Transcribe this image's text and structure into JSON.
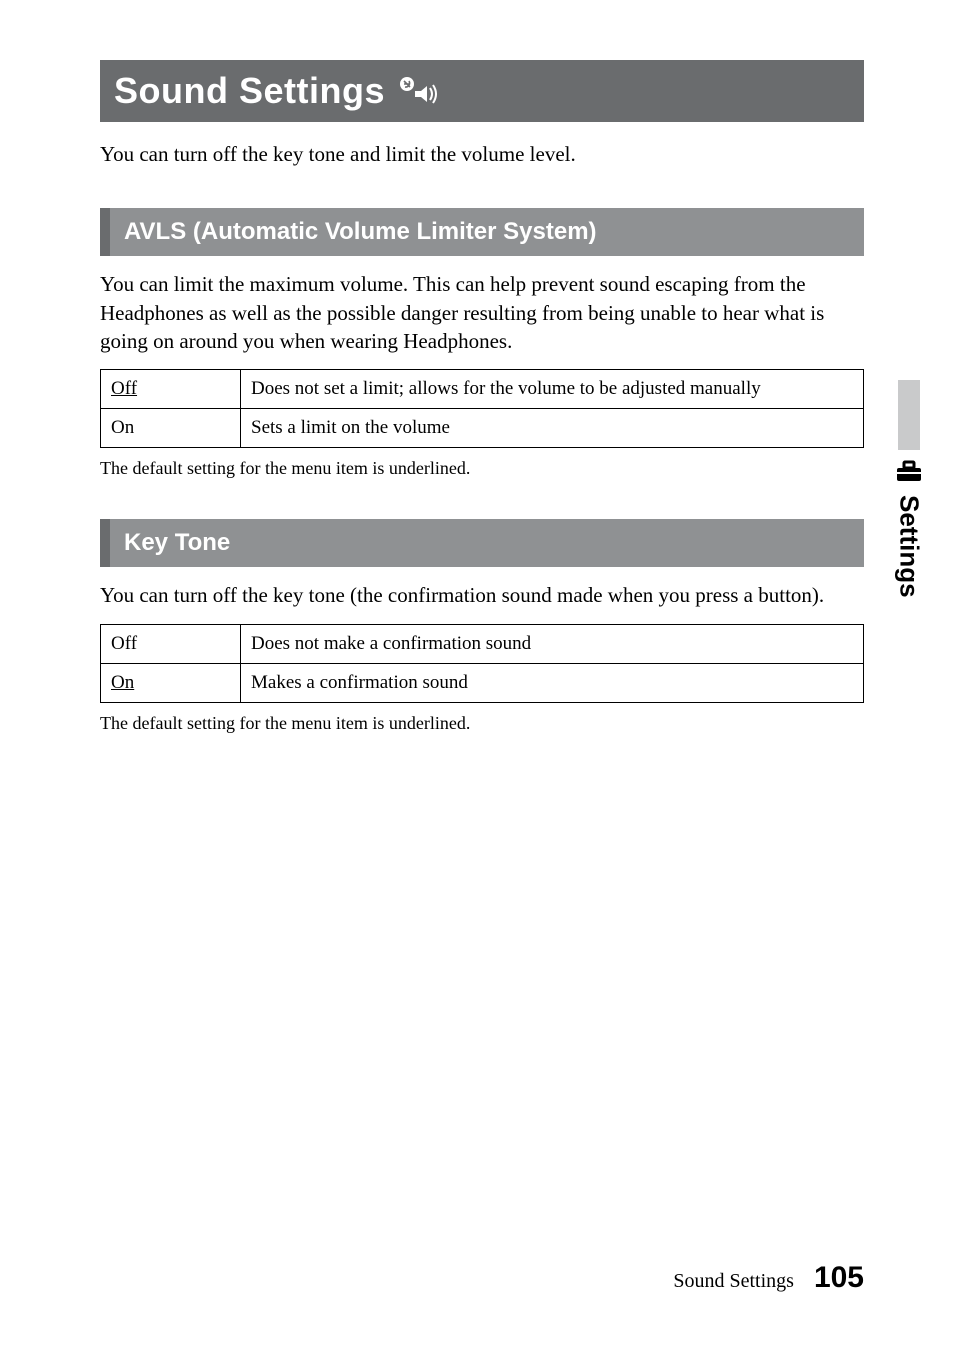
{
  "title": "Sound Settings",
  "intro": "You can turn off the key tone and limit the volume level.",
  "sections": {
    "avls": {
      "heading": "AVLS (Automatic Volume Limiter System)",
      "body": "You can limit the maximum volume. This can help prevent sound escaping from the Headphones as well as the possible danger resulting from being unable to hear what is going on around you when wearing Headphones.",
      "rows": [
        {
          "key": "Off",
          "val": "Does not set a limit; allows for the volume to be adjusted manually",
          "default": true
        },
        {
          "key": "On",
          "val": "Sets a limit on the volume",
          "default": false
        }
      ],
      "caption": "The default setting for the menu item is underlined."
    },
    "keytone": {
      "heading": "Key Tone",
      "body": "You can turn off the key tone (the confirmation sound made when you press a button).",
      "rows": [
        {
          "key": "Off",
          "val": "Does not make a confirmation sound",
          "default": false
        },
        {
          "key": "On",
          "val": "Makes a confirmation sound",
          "default": true
        }
      ],
      "caption": "The default setting for the menu item is underlined."
    }
  },
  "sideTab": "Settings",
  "footer": {
    "label": "Sound Settings",
    "page": "105"
  }
}
